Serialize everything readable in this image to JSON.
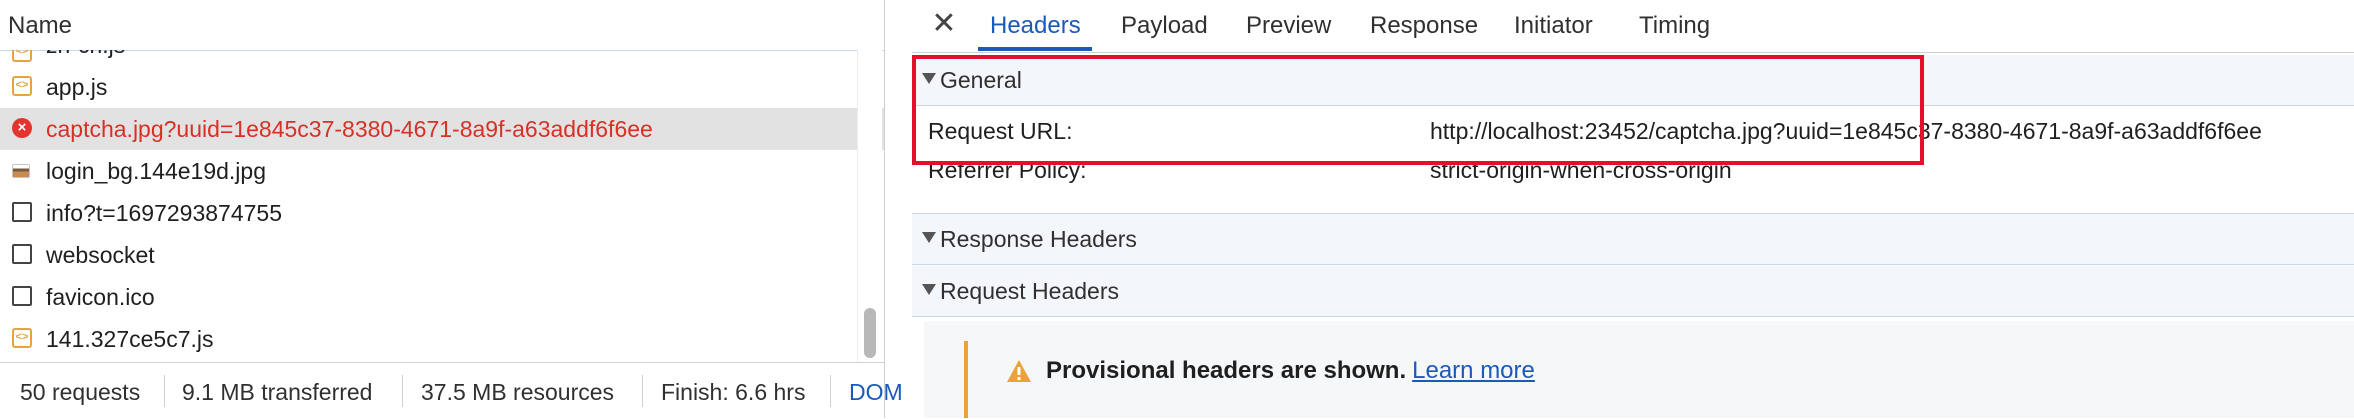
{
  "network_list": {
    "column_header": "Name",
    "requests": [
      {
        "name": "zh-cn.js",
        "type": "script"
      },
      {
        "name": "app.js",
        "type": "script"
      },
      {
        "name": "captcha.jpg?uuid=1e845c37-8380-4671-8a9f-a63addf6f6ee",
        "type": "error"
      },
      {
        "name": "login_bg.144e19d.jpg",
        "type": "image"
      },
      {
        "name": "info?t=1697293874755",
        "type": "document"
      },
      {
        "name": "websocket",
        "type": "document"
      },
      {
        "name": "favicon.ico",
        "type": "document"
      },
      {
        "name": "141.327ce5c7.js",
        "type": "script"
      }
    ],
    "status": {
      "requests": "50 requests",
      "transferred": "9.1 MB transferred",
      "resources": "37.5 MB resources",
      "finish": "Finish: 6.6 hrs",
      "dom": "DOM"
    }
  },
  "details": {
    "close_icon": "close-icon",
    "tabs": [
      "Headers",
      "Payload",
      "Preview",
      "Response",
      "Initiator",
      "Timing"
    ],
    "active_tab": "Headers",
    "general": {
      "title": "General",
      "request_url_label": "Request URL:",
      "request_url_value": "http://localhost:23452/captcha.jpg?uuid=1e845c37-8380-4671-8a9f-a63addf6f6ee",
      "referrer_policy_label": "Referrer Policy:",
      "referrer_policy_value": "strict-origin-when-cross-origin"
    },
    "response_headers_title": "Response Headers",
    "request_headers_title": "Request Headers",
    "warning": {
      "text": "Provisional headers are shown.",
      "link": "Learn more"
    }
  },
  "colors": {
    "accent": "#1a5ab8",
    "error": "#d93025",
    "highlight_box": "#e3102b",
    "warning": "#e8a33a"
  }
}
